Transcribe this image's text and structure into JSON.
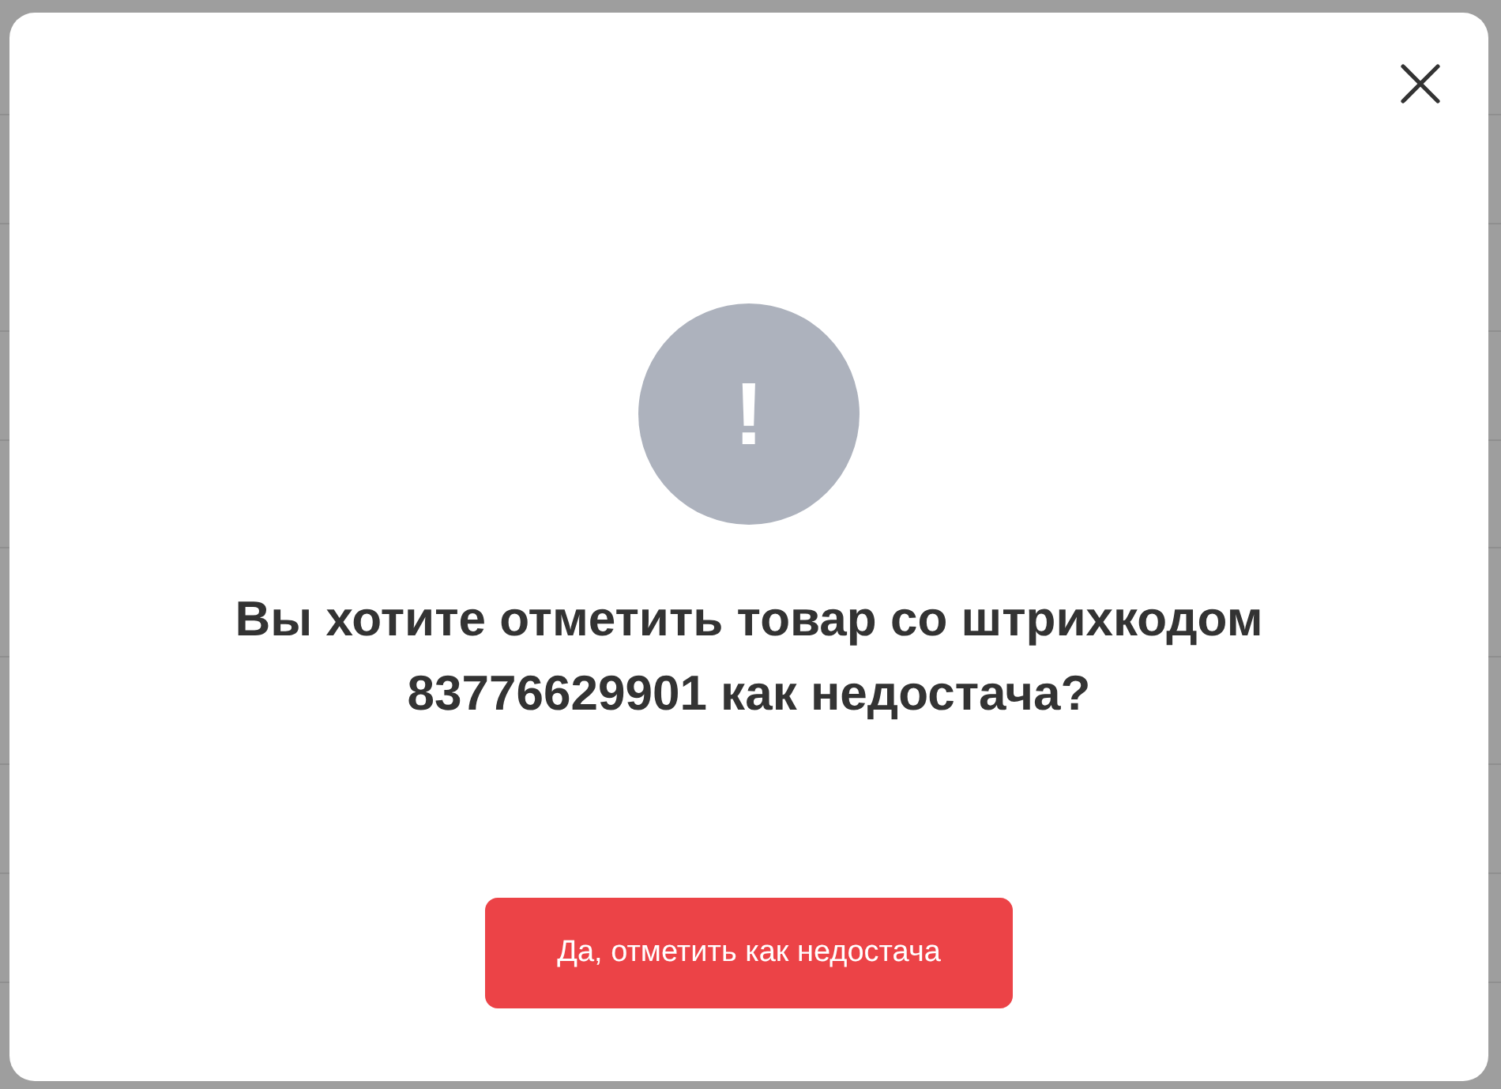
{
  "dialog": {
    "icon": "!",
    "message": "Вы хотите отметить товар со штрихкодом 83776629901 как недостача?",
    "confirm_button": "Да, отметить как недостача"
  }
}
